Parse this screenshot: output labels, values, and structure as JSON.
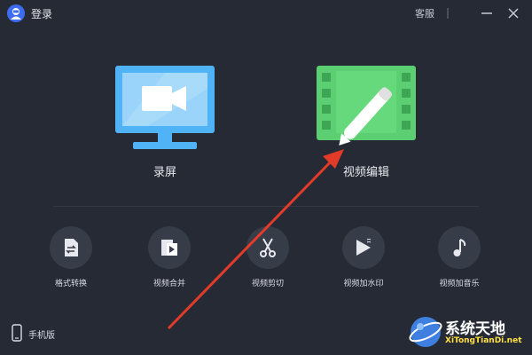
{
  "topbar": {
    "login_label": "登录",
    "service_label": "客服",
    "avatar_icon": "user-avatar-icon",
    "min_icon": "minimize-icon",
    "close_icon": "close-icon",
    "menu_icon": "menu-icon"
  },
  "main": {
    "record": {
      "label": "录屏",
      "icon": "screen-record-icon",
      "color": "#4fb3f5"
    },
    "edit": {
      "label": "视频编辑",
      "icon": "video-edit-icon",
      "color": "#5ccf72"
    }
  },
  "tools": [
    {
      "label": "格式转换",
      "icon": "format-convert-icon"
    },
    {
      "label": "视频合并",
      "icon": "video-merge-icon"
    },
    {
      "label": "视频剪切",
      "icon": "scissors-icon"
    },
    {
      "label": "视频加水印",
      "icon": "watermark-icon"
    },
    {
      "label": "视频加音乐",
      "icon": "music-icon"
    }
  ],
  "mobile": {
    "label": "手机版",
    "icon": "phone-icon"
  },
  "watermark": {
    "title": "系统天地",
    "subtitle": "XiTongTianDi.net"
  },
  "colors": {
    "background": "#262a34",
    "arrow": "#e33b2a"
  }
}
